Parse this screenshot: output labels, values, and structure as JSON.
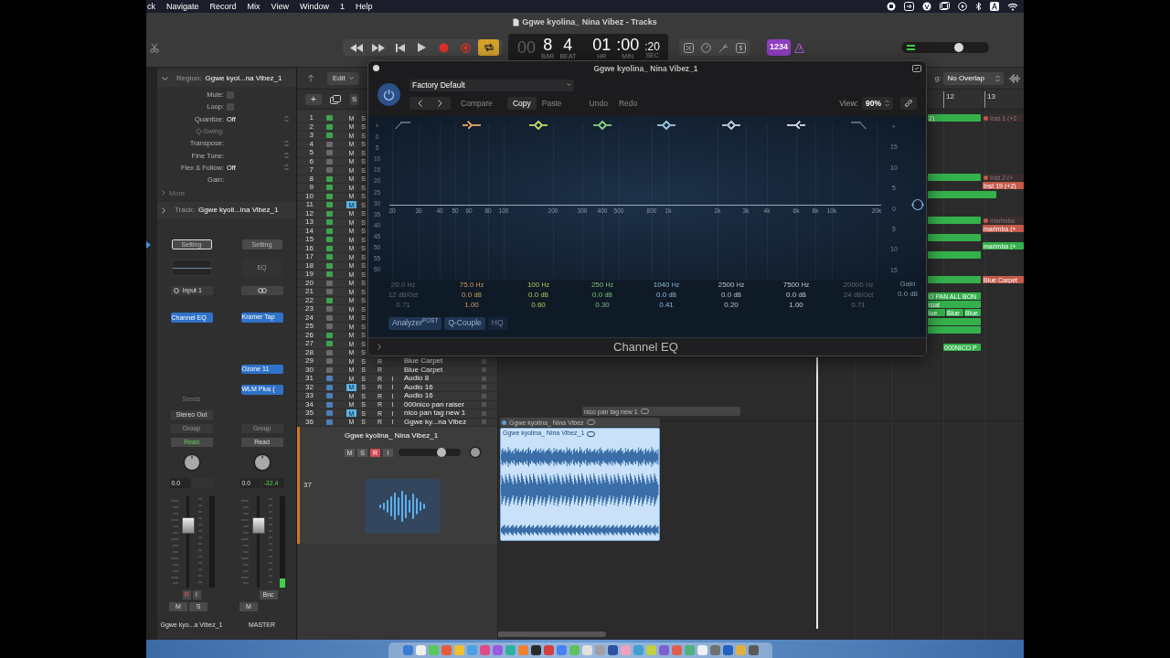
{
  "menu_bar": {
    "items": [
      "ck",
      "Navigate",
      "Record",
      "Mix",
      "View",
      "Window",
      "1",
      "Help"
    ]
  },
  "toolbar": {
    "title": "Ggwe kyolina_ Nina Vibez - Tracks",
    "transport": [
      {
        "kind": "rewind",
        "on": false
      },
      {
        "kind": "forward",
        "on": false
      },
      {
        "kind": "to_start",
        "on": false
      },
      {
        "kind": "play",
        "on": false
      },
      {
        "kind": "record",
        "on": false
      },
      {
        "kind": "capture",
        "on": false
      },
      {
        "kind": "cycle",
        "on": true
      }
    ],
    "lcd": {
      "dim": "00",
      "fields": [
        {
          "value": "8",
          "label": "BAR"
        },
        {
          "value": "4",
          "label": "BEAT"
        },
        {
          "value": "01",
          "label": "HR"
        },
        {
          "value": ":00",
          "label": "MIN"
        },
        {
          "value": ":20",
          "label": "SEC"
        }
      ]
    },
    "count_in": "1234",
    "master_volume": {
      "level": 0.68
    }
  },
  "inspector": {
    "region": {
      "label": "Region:",
      "value": "Ggwe kyol...na Vibez_1",
      "expanded": true
    },
    "params": [
      {
        "label": "Mute:",
        "kind": "checkbox",
        "checked": false,
        "disabled": false
      },
      {
        "label": "Loop:",
        "kind": "checkbox",
        "checked": false,
        "disabled": false
      },
      {
        "label": "Quantize:",
        "kind": "select",
        "value": "Off",
        "disabled": false
      },
      {
        "label": "Q-Swing:",
        "kind": "plain",
        "disabled": true
      },
      {
        "label": "Transpose:",
        "kind": "select",
        "disabled": false
      },
      {
        "label": "Fine Tune:",
        "kind": "select",
        "disabled": false
      },
      {
        "label": "Flex & Follow:",
        "kind": "select",
        "value": "Off",
        "disabled": false
      },
      {
        "label": "Gain:",
        "kind": "plain",
        "disabled": false
      }
    ],
    "more": "More",
    "track": {
      "label": "Track:",
      "value": "Ggwe kyoli...ina Vibez_1",
      "expanded": false
    },
    "strips": [
      {
        "setting": "Setting",
        "selected": true,
        "input": {
          "kind": "input",
          "label": "Input 1"
        },
        "inserts": [
          "Channel EQ"
        ],
        "sends": "Sends",
        "output": "Stereo Out",
        "group": "Group",
        "automation": {
          "label": "Read",
          "active": true
        },
        "volume": "0.0",
        "fader": {
          "level": 0.72
        },
        "meter": {
          "level": 0
        },
        "record": "R",
        "input_monitor": "I",
        "mute": "M",
        "solo": "S",
        "name": "Ggwe kyo...a Vibez_1"
      },
      {
        "setting": "Setting",
        "selected": false,
        "eq_label": "EQ",
        "input": {
          "kind": "link"
        },
        "inserts": [
          "Kramer Tap",
          "Ozone 11",
          "WLM Plus ("
        ],
        "group": "Group",
        "automation": {
          "label": "Read",
          "active": false
        },
        "volume": "0.0",
        "peak": "-32.4",
        "fader": {
          "level": 0.72
        },
        "meter": {
          "level": 0.1
        },
        "bounce": "Bnc",
        "mute": "M",
        "name": "MASTER"
      }
    ]
  },
  "tracks_header": {
    "edit": "Edit",
    "overlap_prefix": "g:",
    "overlap": "No Overlap",
    "new_track": "+",
    "cut": "S",
    "bars": [
      "12",
      "13"
    ]
  },
  "tracks": [
    {
      "number": "1",
      "color": "#3fa34d",
      "mute": "M",
      "mute_on": false,
      "solo": "S"
    },
    {
      "number": "2",
      "color": "#3fa34d",
      "mute": "M",
      "mute_on": false,
      "solo": "S"
    },
    {
      "number": "3",
      "color": "#3fa34d",
      "mute": "M",
      "mute_on": false,
      "solo": "S"
    },
    {
      "number": "4",
      "color": "#6a6a6a",
      "mute": "M",
      "mute_on": false,
      "solo": "S"
    },
    {
      "number": "5",
      "color": "#6a6a6a",
      "mute": "M",
      "mute_on": false,
      "solo": "S"
    },
    {
      "number": "6",
      "color": "#6a6a6a",
      "mute": "M",
      "mute_on": false,
      "solo": "S"
    },
    {
      "number": "7",
      "color": "#6a6a6a",
      "mute": "M",
      "mute_on": false,
      "solo": "S"
    },
    {
      "number": "8",
      "color": "#3fa34d",
      "mute": "M",
      "mute_on": false,
      "solo": "S"
    },
    {
      "number": "9",
      "color": "#3fa34d",
      "mute": "M",
      "mute_on": false,
      "solo": "S"
    },
    {
      "number": "10",
      "color": "#3fa34d",
      "mute": "M",
      "mute_on": false,
      "solo": "S"
    },
    {
      "number": "11",
      "color": "#3fa34d",
      "mute": "M",
      "mute_on": true,
      "solo": "S"
    },
    {
      "number": "12",
      "color": "#3fa34d",
      "mute": "M",
      "mute_on": false,
      "solo": "S"
    },
    {
      "number": "13",
      "color": "#3fa34d",
      "mute": "M",
      "mute_on": false,
      "solo": "S"
    },
    {
      "number": "14",
      "color": "#3fa34d",
      "mute": "M",
      "mute_on": false,
      "solo": "S"
    },
    {
      "number": "15",
      "color": "#3fa34d",
      "mute": "M",
      "mute_on": false,
      "solo": "S"
    },
    {
      "number": "16",
      "color": "#3fa34d",
      "mute": "M",
      "mute_on": false,
      "solo": "S"
    },
    {
      "number": "17",
      "color": "#3fa34d",
      "mute": "M",
      "mute_on": false,
      "solo": "S"
    },
    {
      "number": "18",
      "color": "#3fa34d",
      "mute": "M",
      "mute_on": false,
      "solo": "S"
    },
    {
      "number": "19",
      "color": "#3fa34d",
      "mute": "M",
      "mute_on": false,
      "solo": "S"
    },
    {
      "number": "20",
      "color": "#6a6a6a",
      "mute": "M",
      "mute_on": false,
      "solo": "S"
    },
    {
      "number": "21",
      "color": "#6a6a6a",
      "mute": "M",
      "mute_on": false,
      "solo": "S"
    },
    {
      "number": "22",
      "color": "#3fa34d",
      "mute": "M",
      "mute_on": false,
      "solo": "S"
    },
    {
      "number": "23",
      "color": "#6a6a6a",
      "mute": "M",
      "mute_on": false,
      "solo": "S"
    },
    {
      "number": "24",
      "color": "#6a6a6a",
      "mute": "M",
      "mute_on": false,
      "solo": "S"
    },
    {
      "number": "25",
      "color": "#6a6a6a",
      "mute": "M",
      "mute_on": false,
      "solo": "S"
    },
    {
      "number": "26",
      "color": "#3fa34d",
      "mute": "M",
      "mute_on": false,
      "solo": "S"
    },
    {
      "number": "27",
      "color": "#3fa34d",
      "mute": "M",
      "mute_on": false,
      "solo": "S"
    },
    {
      "number": "28",
      "color": "#6a6a6a",
      "mute": "M",
      "mute_on": false,
      "solo": "S"
    },
    {
      "number": "29",
      "color": "#6a6a6a",
      "mute": "M",
      "mute_on": false,
      "solo": "S",
      "record": "R",
      "name": "Blue Carpet"
    },
    {
      "number": "30",
      "color": "#6a6a6a",
      "mute": "M",
      "mute_on": false,
      "solo": "S",
      "record": "R",
      "name": "Blue Carpet"
    },
    {
      "number": "31",
      "color": "#4d7fb8",
      "mute": "M",
      "mute_on": false,
      "solo": "S",
      "record": "R",
      "input": "I",
      "name": "Audio 8"
    },
    {
      "number": "32",
      "color": "#4d7fb8",
      "mute": "M",
      "mute_on": true,
      "solo": "S",
      "record": "R",
      "input": "I",
      "name": "Audio 16"
    },
    {
      "number": "33",
      "color": "#4d7fb8",
      "mute": "M",
      "mute_on": false,
      "solo": "S",
      "record": "R",
      "input": "I",
      "name": "Audio 16"
    },
    {
      "number": "34",
      "color": "#4d7fb8",
      "mute": "M",
      "mute_on": false,
      "solo": "S",
      "record": "R",
      "input": "I",
      "name": "000nico pan raiser"
    },
    {
      "number": "35",
      "color": "#4d7fb8",
      "mute": "M",
      "mute_on": true,
      "solo": "S",
      "record": "R",
      "input": "I",
      "name": "nico pan tag new 1"
    },
    {
      "number": "36",
      "color": "#4d7fb8",
      "mute": "M",
      "mute_on": false,
      "solo": "S",
      "record": "R",
      "input": "I",
      "name": "Ggwe ky...na Vibez"
    }
  ],
  "selected_track": {
    "number": "37",
    "name": "Ggwe kyolina_ Nina Vibez_1",
    "mute": "M",
    "solo": "S",
    "record": "R",
    "record_on": true,
    "input": "I",
    "volume": {
      "level": 0.72
    }
  },
  "regions": [
    {
      "kind": "midi",
      "label": "2)",
      "color": "#35b14c",
      "muted": false
    },
    {
      "kind": "midi",
      "label": "Inst 1 (+2",
      "color": "#c45a4a",
      "muted": true
    },
    {
      "kind": "midi",
      "color": "#35b14c",
      "muted": false
    },
    {
      "kind": "midi",
      "label": "Inst 2 (+",
      "color": "#c45a4a",
      "muted": true
    },
    {
      "kind": "midi",
      "label": "Inst 19 (+2)",
      "color": "#c45a4a",
      "muted": false
    },
    {
      "kind": "midi",
      "color": "#35b14c",
      "muted": false
    },
    {
      "kind": "midi",
      "color": "#35b14c",
      "muted": false
    },
    {
      "kind": "midi",
      "label": "marimba",
      "color": "#c45a4a",
      "muted": true
    },
    {
      "kind": "midi",
      "label": "marimba (+",
      "color": "#c45a4a",
      "muted": false
    },
    {
      "kind": "midi",
      "color": "#35b14c",
      "muted": false
    },
    {
      "kind": "midi",
      "label": "marimba (+",
      "color": "#35b14c",
      "muted": false
    },
    {
      "kind": "midi",
      "color": "#35b14c",
      "muted": false
    },
    {
      "kind": "midi",
      "color": "#35b14c",
      "muted": false
    },
    {
      "kind": "midi",
      "label": "Blue Carpet",
      "color": "#c45a4a",
      "muted": false
    },
    {
      "kind": "midi",
      "label": "O PAN ALL BON",
      "color": "#35b14c",
      "muted": false
    },
    {
      "kind": "midi",
      "label": "rpat",
      "color": "#35b14c",
      "muted": false
    },
    {
      "kind": "midi",
      "label": "lue",
      "color": "#35b14c",
      "muted": false
    },
    {
      "kind": "midi",
      "label": "Blue",
      "color": "#35b14c",
      "muted": false
    },
    {
      "kind": "midi",
      "label": "Blue",
      "color": "#35b14c",
      "muted": false
    },
    {
      "kind": "midi",
      "color": "#35b14c",
      "muted": false
    },
    {
      "kind": "midi",
      "color": "#35b14c",
      "muted": false
    },
    {
      "kind": "midi",
      "label": "000NICO P",
      "color": "#35b14c",
      "muted": false
    },
    {
      "kind": "track_bar",
      "label": "nico pan tag new 1"
    },
    {
      "kind": "track_bar",
      "label": "Ggwe kyolina_ Nina Vibez",
      "color": "#5b9bd5"
    },
    {
      "kind": "audio",
      "label": "Ggwe kyolina_ Nina Vibez_1"
    }
  ],
  "eq": {
    "title": "Ggwe kyolina_ Nina Vibez_1",
    "power_on": true,
    "preset": "Factory Default",
    "toolbar": [
      {
        "label": "Compare",
        "selected": false
      },
      {
        "label": "Copy",
        "selected": true
      },
      {
        "label": "Paste",
        "selected": false
      },
      {
        "label": "Undo",
        "selected": false
      },
      {
        "label": "Redo",
        "selected": false
      }
    ],
    "view_label": "View:",
    "view_value": "90%",
    "left_scale": [
      "+",
      "0",
      "5",
      "10",
      "15",
      "20",
      "25",
      "30",
      "35",
      "40",
      "45",
      "50",
      "55",
      "60"
    ],
    "right_scale": [
      "+",
      "15",
      "10",
      "5",
      "0",
      "5",
      "10",
      "15"
    ],
    "freq_labels": [
      "20",
      "30",
      "40",
      "50",
      "60",
      "80",
      "100",
      "200",
      "300",
      "400",
      "500",
      "800",
      "1k",
      "2k",
      "3k",
      "4k",
      "6k",
      "8k",
      "10k",
      "20k"
    ],
    "bands": [
      {
        "kind": "low_cut",
        "color": "#5d6875",
        "freq": "20.0",
        "freq_unit": "Hz",
        "gain": "12",
        "gain_unit": "dB/Oct",
        "q": "0.71"
      },
      {
        "kind": "low_shelf",
        "color": "#d39a5c",
        "freq": "75.0",
        "freq_unit": "Hz",
        "gain": "0.0",
        "gain_unit": "dB",
        "q": "1.00"
      },
      {
        "kind": "bell",
        "color": "#b3c45c",
        "freq": "100",
        "freq_unit": "Hz",
        "gain": "0.0",
        "gain_unit": "dB",
        "q": "0.60"
      },
      {
        "kind": "bell",
        "color": "#7cbf7a",
        "freq": "250",
        "freq_unit": "Hz",
        "gain": "0.0",
        "gain_unit": "dB",
        "q": "0.30"
      },
      {
        "kind": "bell",
        "color": "#8fb6d4",
        "freq": "1040",
        "freq_unit": "Hz",
        "gain": "0.0",
        "gain_unit": "dB",
        "q": "0.41"
      },
      {
        "kind": "bell",
        "color": "#b7c0ca",
        "freq": "2500",
        "freq_unit": "Hz",
        "gain": "0.0",
        "gain_unit": "dB",
        "q": "0.20"
      },
      {
        "kind": "high_shelf",
        "color": "#c3cad3",
        "freq": "7500",
        "freq_unit": "Hz",
        "gain": "0.0",
        "gain_unit": "dB",
        "q": "1.00"
      },
      {
        "kind": "high_cut",
        "color": "#5d6875",
        "freq": "20000",
        "freq_unit": "Hz",
        "gain": "24",
        "gain_unit": "dB/Oct",
        "q": "0.71"
      }
    ],
    "gain": {
      "label": "Gain",
      "value": "0.0",
      "unit": "dB"
    },
    "buttons": [
      {
        "label": "Analyzer$^{POST}$",
        "on": true
      },
      {
        "label": "Q-Couple",
        "on": true
      },
      {
        "label": "HQ",
        "on": false
      }
    ],
    "footer": "Channel EQ"
  }
}
